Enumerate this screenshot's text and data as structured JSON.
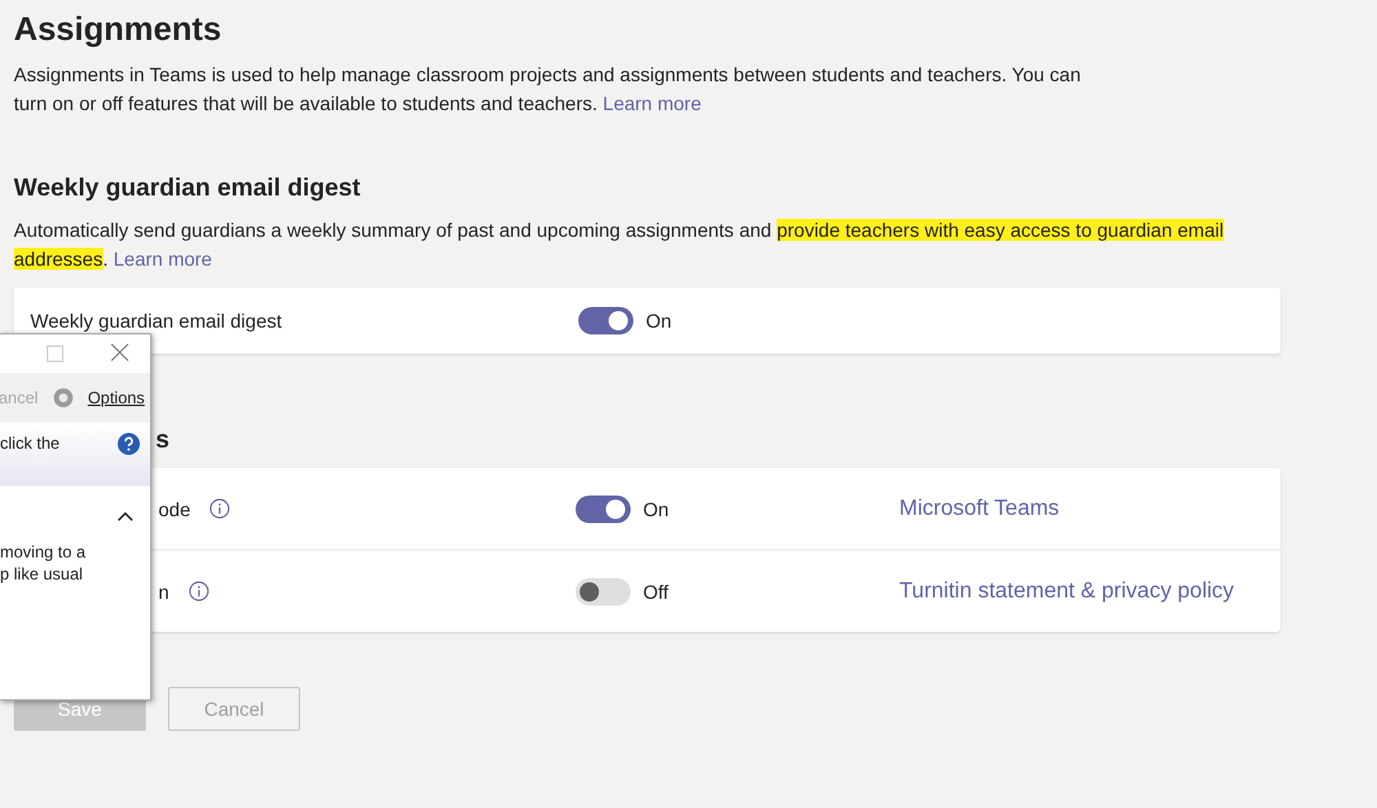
{
  "page": {
    "title": "Assignments",
    "intro": "Assignments in Teams is used to help manage classroom projects and assignments between students and teachers. You can turn on or off features that will be available to students and teachers.",
    "intro_link": "Learn more"
  },
  "digest_section": {
    "heading": "Weekly guardian email digest",
    "text_before": "Automatically send guardians a weekly summary of past and upcoming assignments and ",
    "highlighted": "provide teachers with easy access to guardian email addresses",
    "text_after": ".",
    "link": "Learn more",
    "rows": [
      {
        "label": "Weekly guardian email digest",
        "info": false,
        "on": true,
        "state_text": "On"
      }
    ]
  },
  "second_section": {
    "heading": "s",
    "rows": [
      {
        "label": "ode",
        "info": true,
        "on": true,
        "state_text": "On",
        "link": "Microsoft Teams"
      },
      {
        "label": "n",
        "info": true,
        "on": false,
        "state_text": "Off",
        "link": "Turnitin statement & privacy policy"
      }
    ]
  },
  "buttons": [
    {
      "label": "Save",
      "kind": "primary",
      "disabled": true
    },
    {
      "label": "Cancel",
      "kind": "secondary",
      "disabled": true
    }
  ],
  "popup": {
    "toolbar_cancel": "ancel",
    "toolbar_options": "Options",
    "help_text": "click the",
    "body_lines": [
      "moving to a",
      "p like usual"
    ]
  }
}
